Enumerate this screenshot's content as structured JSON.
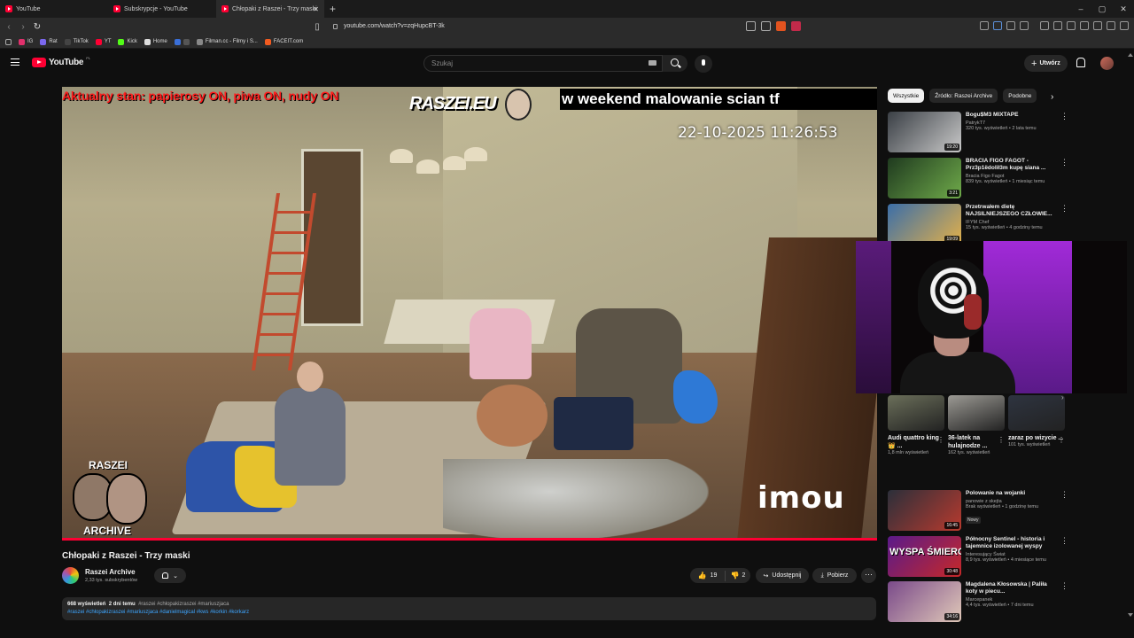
{
  "browser": {
    "tabs": [
      {
        "label": "YouTube",
        "active": false
      },
      {
        "label": "Subskrypcje - YouTube",
        "active": false
      },
      {
        "label": "Chłopaki z Raszei - Trzy maski",
        "active": true
      }
    ],
    "url": "youtube.com/watch?v=zqHupcBT-3k",
    "bookmarks": [
      "IG",
      "Rat",
      "TikTok",
      "YT",
      "Kick",
      "Home",
      "Filman.cc - Filmy i S...",
      "FACEIT.com"
    ],
    "bookmark_colors": [
      "#e1306c",
      "#7b68ee",
      "#222222",
      "#ff0033",
      "#53fc18",
      "#dddddd",
      "#3a6fd8",
      "#f25b20"
    ]
  },
  "header": {
    "logo": "YouTube",
    "logo_region": "PL",
    "search_placeholder": "Szukaj",
    "create_label": "Utwórz"
  },
  "player": {
    "overlay_left": "Aktualny stan: papierosy ON, piwa ON, nudy ON",
    "overlay_brand": "RASZEI.EU",
    "overlay_ticker": "w weekend malowanie scian tf",
    "timestamp": "22-10-2025 11:26:53",
    "badge_top": "RASZEI",
    "badge_bottom": "ARCHIVE",
    "camera_brand": "imou",
    "progress": 1.0
  },
  "video": {
    "title": "Chłopaki z Raszei - Trzy maski",
    "channel": "Raszei Archive",
    "subscribers": "2,33 tys. subskrybentów",
    "likes": "19",
    "dislikes": "2",
    "share_label": "Udostępnij",
    "download_label": "Pobierz",
    "views": "668 wyświetleń",
    "age": "2 dni temu",
    "tags_line1": "#raszei #chłopakizraszei #mariuszjaca",
    "tags_line2": "#raszei #chłopakizraszei #mariuszjaca #danielmagical #kws #korkin #korkarz"
  },
  "sidebar": {
    "chips": [
      "Wszystkie",
      "Źródło: Raszei Archive",
      "Podobne"
    ],
    "recommendations": [
      {
        "title": "Bogu$M3 MIXTAPE",
        "channel": "PatrykT7",
        "views": "320 tys. wyświetleń • 2 lata temu",
        "duration": "19:20",
        "colors": [
          "#3a3f45",
          "#c9c9c9"
        ]
      },
      {
        "title": "BRACIA FIGO FAGOT - Prz3p1ëdolił3m kupę siana ...",
        "channel": "Bracia Figo Fagot",
        "views": "839 tys. wyświetleń • 1 miesiąc temu",
        "duration": "3:21",
        "colors": [
          "#1f3a1f",
          "#6faa4a"
        ]
      },
      {
        "title": "Przetrwałem dietę NAJSILNIEJSZEGO CZŁOWIE...",
        "channel": "IFYM Chef",
        "views": "15 tys. wyświetleń • 4 godziny temu",
        "duration": "19:09",
        "colors": [
          "#3b6ea8",
          "#e2b04a"
        ]
      }
    ],
    "shorts": [
      {
        "title": "Audi quattro king 👑 ...",
        "views": "1,8 mln wyświetleń",
        "color": "#6b6f5a"
      },
      {
        "title": "36-latek na hulajnodze ...",
        "views": "162 tys. wyświetleń",
        "color": "#9c9a94"
      },
      {
        "title": "zaraz po wizycie ...",
        "views": "101 tys. wyświetleń",
        "color": "#2e3440"
      }
    ],
    "more_recommendations": [
      {
        "title": "Polowanie na wojanki",
        "channel": "panowie z skejta",
        "views": "Brak wyświetleń • 1 godzinę temu",
        "duration": "16:45",
        "badge": "Nowy",
        "colors": [
          "#2b2f3a",
          "#b83a2e"
        ]
      },
      {
        "title": "Północny Sentinel - historia i tajemnice izolowanej wyspy",
        "channel": "Interesujący Świat",
        "views": "8,9 tys. wyświetleń • 4 miesiące temu",
        "duration": "30:48",
        "badge": "",
        "colors": [
          "#5a1a8a",
          "#c62828"
        ],
        "thumb_text": "WYSPA ŚMIERCI"
      },
      {
        "title": "Magdalena Kłosowska | Paliła koty w piecu...",
        "channel": "Marcepanek",
        "views": "4,4 tys. wyświetleń • 7 dni temu",
        "duration": "34:16",
        "badge": "",
        "colors": [
          "#7a4a8a",
          "#e0c8b8"
        ]
      }
    ]
  }
}
